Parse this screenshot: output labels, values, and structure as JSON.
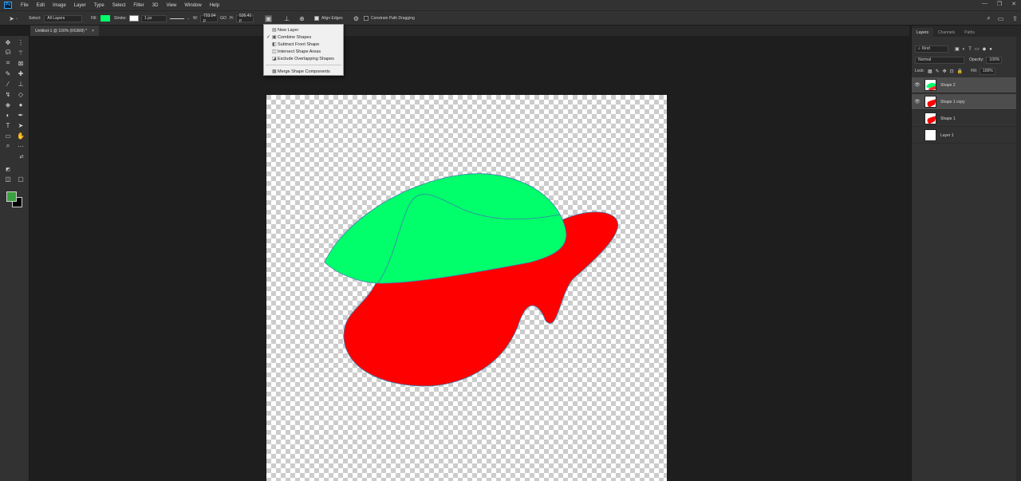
{
  "app": {
    "logo": "Ps"
  },
  "menubar": {
    "items": [
      "File",
      "Edit",
      "Image",
      "Layer",
      "Type",
      "Select",
      "Filter",
      "3D",
      "View",
      "Window",
      "Help"
    ]
  },
  "window_controls": [
    "—",
    "❐",
    "✕"
  ],
  "options": {
    "select_label": "Select:",
    "select_value": "All Layers",
    "fill_label": "Fill:",
    "fill_color": "#00ff6a",
    "stroke_label": "Stroke:",
    "stroke_width": "1 px",
    "w_label": "W:",
    "w_value": "733.04 p",
    "link_label": "GO",
    "h_label": "H:",
    "h_value": "526.41 p",
    "align_edges": "Align Edges",
    "constrain": "Constrain Path Dragging"
  },
  "document": {
    "tab_title": "Untitled-1 @ 100% (RGB/8) *",
    "tab_close": "×"
  },
  "path_ops_menu": {
    "items": [
      {
        "label": "New Layer",
        "checked": false,
        "icon": "new-layer-icon"
      },
      {
        "label": "Combine Shapes",
        "checked": true,
        "icon": "combine-shapes-icon"
      },
      {
        "label": "Subtract Front Shape",
        "checked": false,
        "icon": "subtract-front-icon"
      },
      {
        "label": "Intersect Shape Areas",
        "checked": false,
        "icon": "intersect-icon"
      },
      {
        "label": "Exclude Overlapping Shapes",
        "checked": false,
        "icon": "exclude-overlap-icon"
      }
    ],
    "merge_label": "Merge Shape Components"
  },
  "layers_panel": {
    "tabs": [
      "Layers",
      "Channels",
      "Paths"
    ],
    "filter_kind": "Kind",
    "blend_mode": "Normal",
    "opacity_label": "Opacity:",
    "opacity_value": "100%",
    "lock_label": "Lock:",
    "fill_label": "Fill:",
    "fill_value": "100%",
    "layers": [
      {
        "name": "Shape 2",
        "visible": true,
        "selected": true
      },
      {
        "name": "Shape 1 copy",
        "visible": true,
        "selected": true
      },
      {
        "name": "Shape 1",
        "visible": false,
        "selected": false
      },
      {
        "name": "Layer 1",
        "visible": false,
        "selected": false
      }
    ]
  },
  "colors": {
    "foreground": "#3aa040",
    "background": "#000000",
    "green_shape": "#00ff6a",
    "red_shape": "#ff0000",
    "accent": "#31a8ff"
  }
}
